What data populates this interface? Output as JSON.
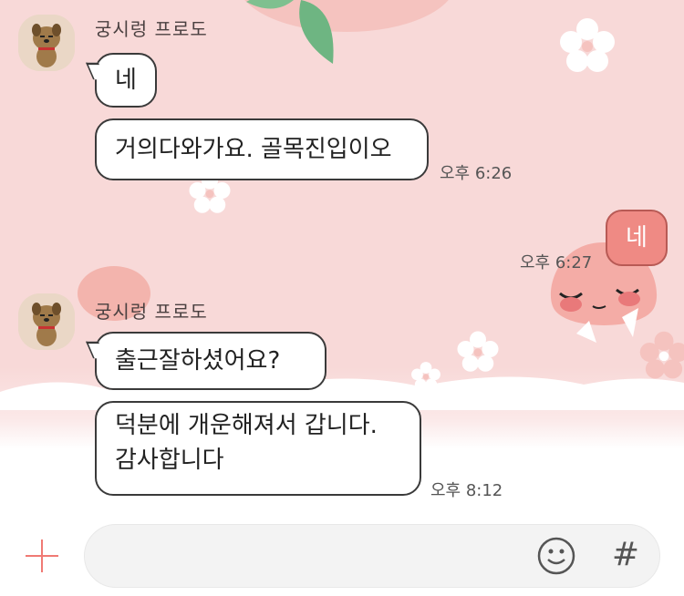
{
  "messages": [
    {
      "sender": "궁시렁 프로도",
      "bubbles": [
        "네",
        "거의다와가요. 골목진입이오"
      ],
      "time": "오후 6:26"
    },
    {
      "me": true,
      "text": "네",
      "time": "오후 6:27"
    },
    {
      "sender": "궁시렁 프로도",
      "bubbles": [
        "출근잘하셨어요?",
        "덕분에 개운해져서 갑니다. 감사합니다"
      ],
      "time": "오후 8:12"
    }
  ],
  "input": {
    "placeholder": "",
    "plus_icon": "plus-icon",
    "emoji_icon": "smiley-icon",
    "hash_icon": "hash-icon",
    "hash_glyph": "#"
  },
  "colors": {
    "background": "#f8d9d8",
    "my_bubble": "#ef8a84",
    "accent": "#f07a74"
  }
}
